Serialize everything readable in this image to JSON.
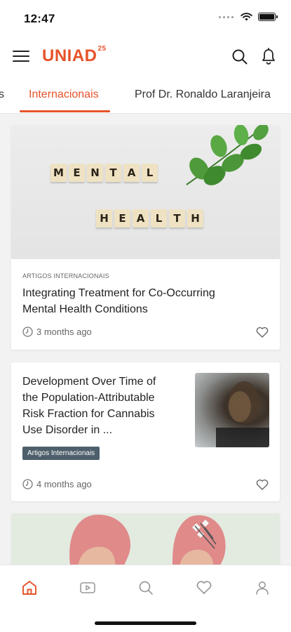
{
  "status_bar": {
    "time": "12:47"
  },
  "app_bar": {
    "logo_text": "UNIAD",
    "logo_superscript": "25"
  },
  "tabs": [
    {
      "label": "s"
    },
    {
      "label": "Internacionais",
      "active": true
    },
    {
      "label": "Prof Dr. Ronaldo Laranjeira"
    }
  ],
  "articles": [
    {
      "category": "ARTIGOS INTERNACIONAIS",
      "title_line1": "Integrating Treatment for Co-Occurring",
      "title_line2": "Mental Health Conditions",
      "time": "3 months ago",
      "image_words": [
        "MENTAL",
        "HEALTH"
      ]
    },
    {
      "title_line1": "Development Over Time of",
      "title_line2": "the Population-Attributable",
      "title_line3": "Risk Fraction for Cannabis",
      "title_line4": "Use Disorder in ...",
      "badge": "Artigos Internacionais",
      "time": "4 months ago"
    }
  ],
  "bottom_nav": [
    "home-icon",
    "video-icon",
    "search-icon",
    "heart-icon",
    "profile-icon"
  ],
  "colors": {
    "accent": "#e6532a",
    "badge": "#4d5f6b"
  }
}
